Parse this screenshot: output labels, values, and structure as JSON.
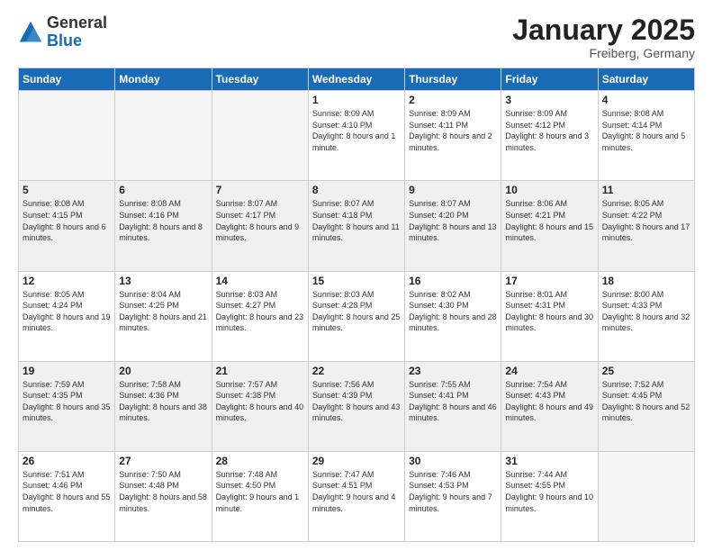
{
  "logo": {
    "general": "General",
    "blue": "Blue"
  },
  "header": {
    "title": "January 2025",
    "subtitle": "Freiberg, Germany"
  },
  "weekdays": [
    "Sunday",
    "Monday",
    "Tuesday",
    "Wednesday",
    "Thursday",
    "Friday",
    "Saturday"
  ],
  "weeks": [
    [
      {
        "day": "",
        "empty": true
      },
      {
        "day": "",
        "empty": true
      },
      {
        "day": "",
        "empty": true
      },
      {
        "day": "1",
        "sunrise": "8:09 AM",
        "sunset": "4:10 PM",
        "daylight": "8 hours and 1 minute."
      },
      {
        "day": "2",
        "sunrise": "8:09 AM",
        "sunset": "4:11 PM",
        "daylight": "8 hours and 2 minutes."
      },
      {
        "day": "3",
        "sunrise": "8:09 AM",
        "sunset": "4:12 PM",
        "daylight": "8 hours and 3 minutes."
      },
      {
        "day": "4",
        "sunrise": "8:08 AM",
        "sunset": "4:14 PM",
        "daylight": "8 hours and 5 minutes."
      }
    ],
    [
      {
        "day": "5",
        "sunrise": "8:08 AM",
        "sunset": "4:15 PM",
        "daylight": "8 hours and 6 minutes."
      },
      {
        "day": "6",
        "sunrise": "8:08 AM",
        "sunset": "4:16 PM",
        "daylight": "8 hours and 8 minutes."
      },
      {
        "day": "7",
        "sunrise": "8:07 AM",
        "sunset": "4:17 PM",
        "daylight": "8 hours and 9 minutes."
      },
      {
        "day": "8",
        "sunrise": "8:07 AM",
        "sunset": "4:18 PM",
        "daylight": "8 hours and 11 minutes."
      },
      {
        "day": "9",
        "sunrise": "8:07 AM",
        "sunset": "4:20 PM",
        "daylight": "8 hours and 13 minutes."
      },
      {
        "day": "10",
        "sunrise": "8:06 AM",
        "sunset": "4:21 PM",
        "daylight": "8 hours and 15 minutes."
      },
      {
        "day": "11",
        "sunrise": "8:05 AM",
        "sunset": "4:22 PM",
        "daylight": "8 hours and 17 minutes."
      }
    ],
    [
      {
        "day": "12",
        "sunrise": "8:05 AM",
        "sunset": "4:24 PM",
        "daylight": "8 hours and 19 minutes."
      },
      {
        "day": "13",
        "sunrise": "8:04 AM",
        "sunset": "4:25 PM",
        "daylight": "8 hours and 21 minutes."
      },
      {
        "day": "14",
        "sunrise": "8:03 AM",
        "sunset": "4:27 PM",
        "daylight": "8 hours and 23 minutes."
      },
      {
        "day": "15",
        "sunrise": "8:03 AM",
        "sunset": "4:28 PM",
        "daylight": "8 hours and 25 minutes."
      },
      {
        "day": "16",
        "sunrise": "8:02 AM",
        "sunset": "4:30 PM",
        "daylight": "8 hours and 28 minutes."
      },
      {
        "day": "17",
        "sunrise": "8:01 AM",
        "sunset": "4:31 PM",
        "daylight": "8 hours and 30 minutes."
      },
      {
        "day": "18",
        "sunrise": "8:00 AM",
        "sunset": "4:33 PM",
        "daylight": "8 hours and 32 minutes."
      }
    ],
    [
      {
        "day": "19",
        "sunrise": "7:59 AM",
        "sunset": "4:35 PM",
        "daylight": "8 hours and 35 minutes."
      },
      {
        "day": "20",
        "sunrise": "7:58 AM",
        "sunset": "4:36 PM",
        "daylight": "8 hours and 38 minutes."
      },
      {
        "day": "21",
        "sunrise": "7:57 AM",
        "sunset": "4:38 PM",
        "daylight": "8 hours and 40 minutes."
      },
      {
        "day": "22",
        "sunrise": "7:56 AM",
        "sunset": "4:39 PM",
        "daylight": "8 hours and 43 minutes."
      },
      {
        "day": "23",
        "sunrise": "7:55 AM",
        "sunset": "4:41 PM",
        "daylight": "8 hours and 46 minutes."
      },
      {
        "day": "24",
        "sunrise": "7:54 AM",
        "sunset": "4:43 PM",
        "daylight": "8 hours and 49 minutes."
      },
      {
        "day": "25",
        "sunrise": "7:52 AM",
        "sunset": "4:45 PM",
        "daylight": "8 hours and 52 minutes."
      }
    ],
    [
      {
        "day": "26",
        "sunrise": "7:51 AM",
        "sunset": "4:46 PM",
        "daylight": "8 hours and 55 minutes."
      },
      {
        "day": "27",
        "sunrise": "7:50 AM",
        "sunset": "4:48 PM",
        "daylight": "8 hours and 58 minutes."
      },
      {
        "day": "28",
        "sunrise": "7:48 AM",
        "sunset": "4:50 PM",
        "daylight": "9 hours and 1 minute."
      },
      {
        "day": "29",
        "sunrise": "7:47 AM",
        "sunset": "4:51 PM",
        "daylight": "9 hours and 4 minutes."
      },
      {
        "day": "30",
        "sunrise": "7:46 AM",
        "sunset": "4:53 PM",
        "daylight": "9 hours and 7 minutes."
      },
      {
        "day": "31",
        "sunrise": "7:44 AM",
        "sunset": "4:55 PM",
        "daylight": "9 hours and 10 minutes."
      },
      {
        "day": "",
        "empty": true
      }
    ]
  ]
}
